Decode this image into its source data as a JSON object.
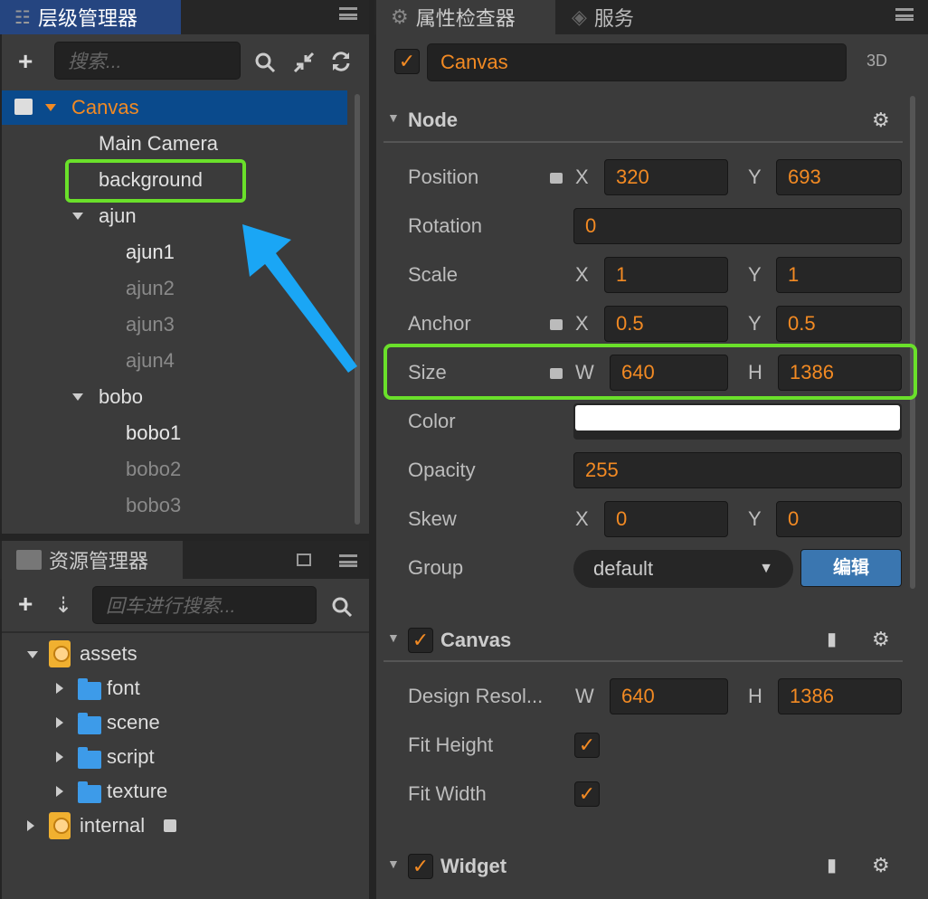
{
  "hierarchy": {
    "title": "层级管理器",
    "search_placeholder": "搜索...",
    "icons": [
      "plus-icon",
      "search-icon",
      "collapse-icon",
      "refresh-icon"
    ],
    "items": [
      {
        "label": "Canvas",
        "level": 0,
        "expanded": true,
        "selected": true
      },
      {
        "label": "Main Camera",
        "level": 1
      },
      {
        "label": "background",
        "level": 1,
        "highlighted": true
      },
      {
        "label": "ajun",
        "level": 1,
        "expanded": true
      },
      {
        "label": "ajun1",
        "level": 2
      },
      {
        "label": "ajun2",
        "level": 2,
        "inactive": true
      },
      {
        "label": "ajun3",
        "level": 2,
        "inactive": true
      },
      {
        "label": "ajun4",
        "level": 2,
        "inactive": true
      },
      {
        "label": "bobo",
        "level": 1,
        "expanded": true
      },
      {
        "label": "bobo1",
        "level": 2
      },
      {
        "label": "bobo2",
        "level": 2,
        "inactive": true
      },
      {
        "label": "bobo3",
        "level": 2,
        "inactive": true
      }
    ]
  },
  "assets": {
    "title": "资源管理器",
    "search_placeholder": "回车进行搜索...",
    "items": [
      {
        "label": "assets",
        "type": "db",
        "level": 0,
        "expanded": true
      },
      {
        "label": "font",
        "type": "folder",
        "level": 1
      },
      {
        "label": "scene",
        "type": "folder",
        "level": 1
      },
      {
        "label": "script",
        "type": "folder",
        "level": 1
      },
      {
        "label": "texture",
        "type": "folder",
        "level": 1
      },
      {
        "label": "internal",
        "type": "db",
        "level": 0,
        "locked": true
      }
    ]
  },
  "inspector": {
    "tab_active": "属性检查器",
    "tab_other": "服务",
    "node_name": "Canvas",
    "mode": "3D",
    "node_section": "Node",
    "props": [
      {
        "label": "Position",
        "lock": true,
        "a": "X",
        "av": "320",
        "b": "Y",
        "bv": "693"
      },
      {
        "label": "Rotation",
        "single": "0"
      },
      {
        "label": "Scale",
        "a": "X",
        "av": "1",
        "b": "Y",
        "bv": "1"
      },
      {
        "label": "Anchor",
        "lock": true,
        "a": "X",
        "av": "0.5",
        "b": "Y",
        "bv": "0.5"
      },
      {
        "label": "Size",
        "lock": true,
        "a": "W",
        "av": "640",
        "b": "H",
        "bv": "1386",
        "highlighted": true
      },
      {
        "label": "Color",
        "color": "#ffffff"
      },
      {
        "label": "Opacity",
        "single": "255"
      },
      {
        "label": "Skew",
        "a": "X",
        "av": "0",
        "b": "Y",
        "bv": "0"
      },
      {
        "label": "Group",
        "select": "default",
        "button": "编辑"
      }
    ],
    "canvas_section": "Canvas",
    "canvas_props": [
      {
        "label": "Design Resol...",
        "a": "W",
        "av": "640",
        "b": "H",
        "bv": "1386"
      },
      {
        "label": "Fit Height",
        "checked": true
      },
      {
        "label": "Fit Width",
        "checked": true
      }
    ],
    "widget_section": "Widget"
  },
  "colors": {
    "accent": "#f28a23",
    "selection": "#0a4a8c",
    "highlight": "#6ae02a",
    "arrow": "#1aa6f5",
    "button": "#3a76b0"
  }
}
